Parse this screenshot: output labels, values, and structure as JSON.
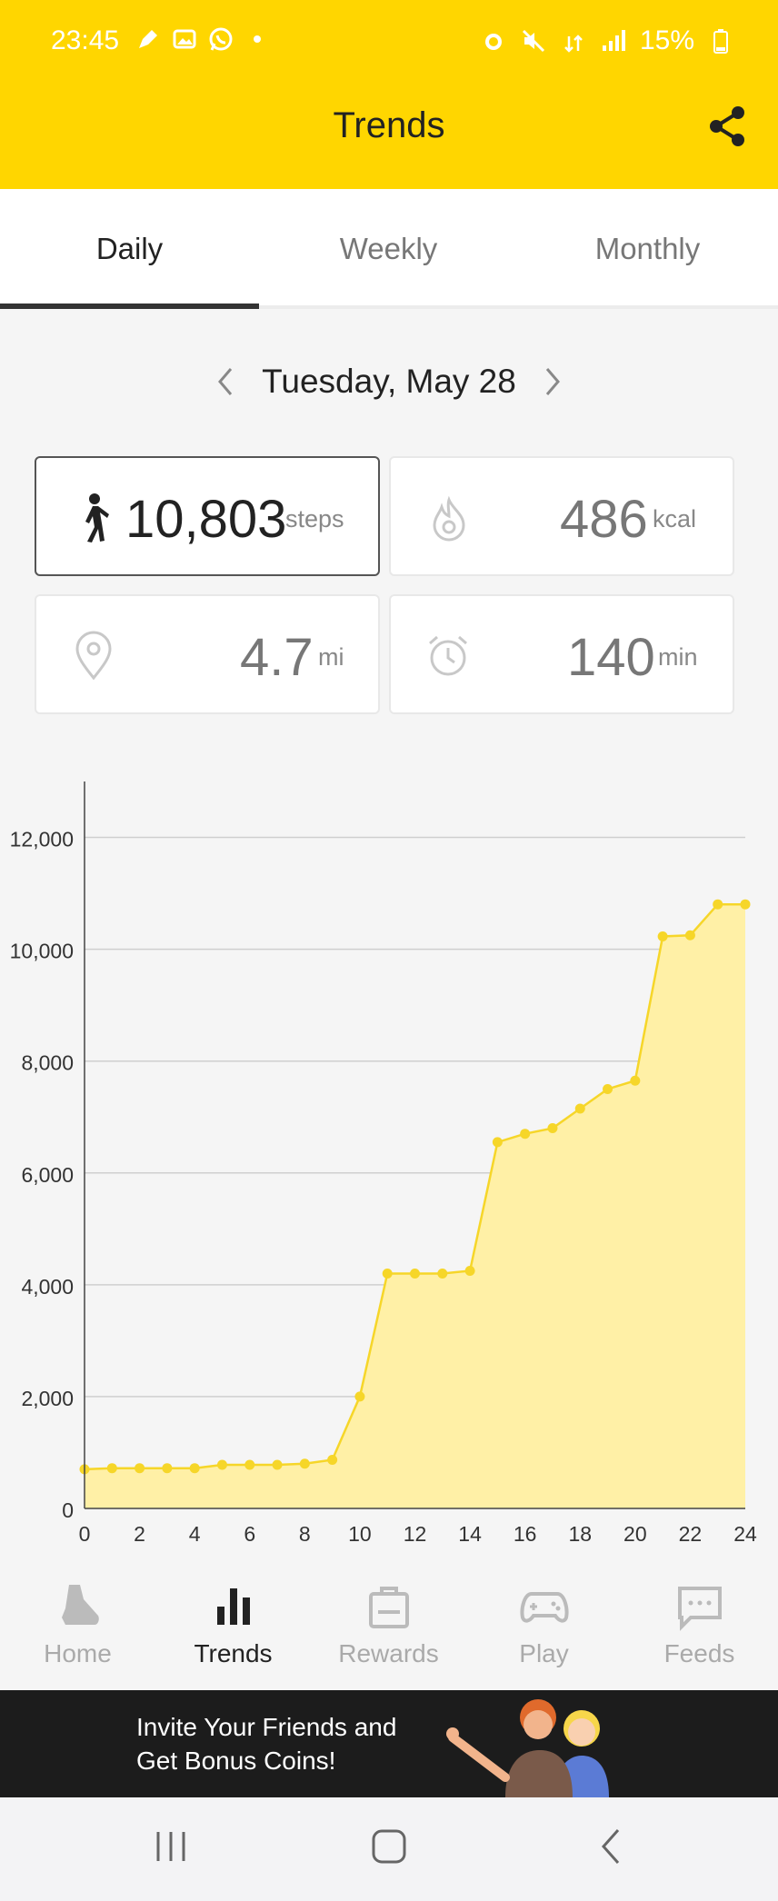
{
  "status": {
    "time": "23:45",
    "battery": "15%"
  },
  "header": {
    "title": "Trends"
  },
  "tabs": [
    {
      "label": "Daily",
      "active": true
    },
    {
      "label": "Weekly",
      "active": false
    },
    {
      "label": "Monthly",
      "active": false
    }
  ],
  "date": {
    "label": "Tuesday, May 28"
  },
  "stats": {
    "steps": {
      "value": "10,803",
      "unit": "steps",
      "icon": "walker-icon"
    },
    "calories": {
      "value": "486",
      "unit": "kcal",
      "icon": "flame-icon"
    },
    "distance": {
      "value": "4.7",
      "unit": "mi",
      "icon": "location-pin-icon"
    },
    "time": {
      "value": "140",
      "unit": "min",
      "icon": "alarm-clock-icon"
    }
  },
  "chart_data": {
    "type": "area",
    "x": [
      0,
      1,
      2,
      3,
      4,
      5,
      6,
      7,
      8,
      9,
      10,
      11,
      12,
      13,
      14,
      15,
      16,
      17,
      18,
      19,
      20,
      21,
      22,
      23,
      24
    ],
    "values": [
      700,
      720,
      720,
      720,
      720,
      780,
      780,
      780,
      800,
      870,
      2000,
      4200,
      4200,
      4200,
      4250,
      6550,
      6700,
      6800,
      7150,
      7500,
      7650,
      10230,
      10250,
      10803,
      10803
    ],
    "xticks": [
      "0",
      "2",
      "4",
      "6",
      "8",
      "10",
      "12",
      "14",
      "16",
      "18",
      "20",
      "22",
      "24"
    ],
    "yticks": [
      "0",
      "2,000",
      "4,000",
      "6,000",
      "8,000",
      "10,000",
      "12,000"
    ],
    "xlim": [
      0,
      24
    ],
    "ylim": [
      0,
      13000
    ],
    "grid": true,
    "color": "#F6D629",
    "fill": "#FFF0A6"
  },
  "nav": [
    {
      "label": "Home",
      "icon": "shoe-icon",
      "active": false
    },
    {
      "label": "Trends",
      "icon": "bar-chart-icon",
      "active": true
    },
    {
      "label": "Rewards",
      "icon": "shopping-bag-icon",
      "active": false
    },
    {
      "label": "Play",
      "icon": "gamepad-icon",
      "active": false
    },
    {
      "label": "Feeds",
      "icon": "chat-bubble-icon",
      "active": false
    }
  ],
  "banner": {
    "line1": "Invite Your Friends and",
    "line2": "Get Bonus Coins!"
  },
  "colors": {
    "brand": "#FFD600",
    "accent_line": "#F6D629"
  }
}
